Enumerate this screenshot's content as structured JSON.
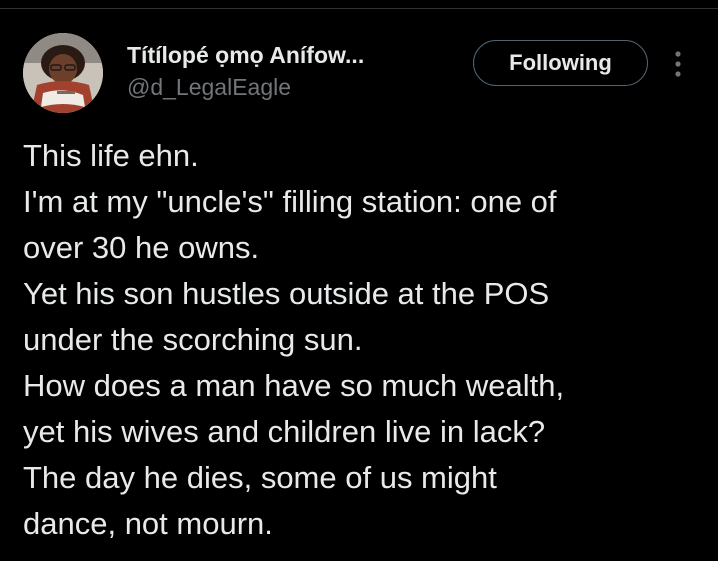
{
  "author": {
    "display_name": "Títílopé ọmọ Anífow...",
    "handle": "@d_LegalEagle",
    "avatar_icon": "profile-photo"
  },
  "actions": {
    "follow_label": "Following",
    "more_icon": "vertical-ellipsis-icon"
  },
  "tweet": {
    "lines": [
      "This life ehn.",
      "I'm at my \"uncle's\" filling station: one of",
      "over 30 he owns.",
      "Yet his son hustles outside at the POS",
      "under the scorching sun.",
      "How does a man have so much wealth,",
      "yet his wives and children live in lack?",
      "The day he dies, some of us might",
      "dance, not mourn."
    ]
  },
  "colors": {
    "background": "#000000",
    "primary_text": "#e7e9ea",
    "secondary_text": "#71767b",
    "button_border": "#536471"
  }
}
